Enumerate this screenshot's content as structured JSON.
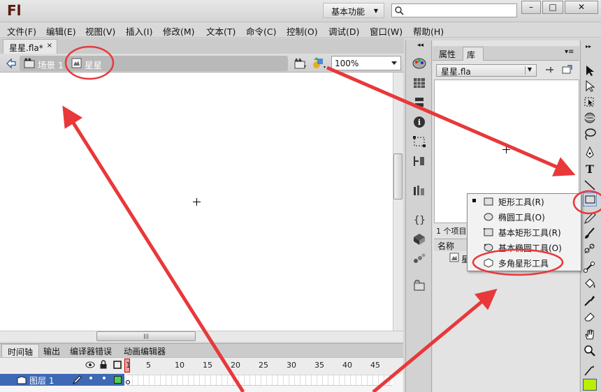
{
  "app": {
    "logo": "Fl",
    "workspace": "基本功能",
    "window_min": "–",
    "window_max": "□",
    "window_close": "✕"
  },
  "menu": [
    "文件(F)",
    "编辑(E)",
    "视图(V)",
    "插入(I)",
    "修改(M)",
    "文本(T)",
    "命令(C)",
    "控制(O)",
    "调试(D)",
    "窗口(W)",
    "帮助(H)"
  ],
  "document": {
    "tab": "星星.fla*",
    "tab_close": "×"
  },
  "editbar": {
    "scene": "场景 1",
    "symbol": "星星",
    "zoom": "100%"
  },
  "timeline": {
    "tabs": [
      "时间轴",
      "输出",
      "编译器错误",
      "动画编辑器"
    ],
    "frame_numbers": [
      "1",
      "5",
      "10",
      "15",
      "20",
      "25",
      "30",
      "35",
      "40",
      "45"
    ],
    "layer": "图层 1"
  },
  "library": {
    "tabs": [
      "属性",
      "库"
    ],
    "file": "星星.fla",
    "count": "1 个项目",
    "column_name": "名称",
    "item": "星"
  },
  "tool_popup": [
    "矩形工具(R)",
    "椭圆工具(O)",
    "基本矩形工具(R)",
    "基本椭圆工具(O)",
    "多角星形工具"
  ],
  "colors": {
    "accent_red": "#e8383a",
    "layer_selected": "#3e69b5",
    "fill_swatch": "#b8f000"
  }
}
